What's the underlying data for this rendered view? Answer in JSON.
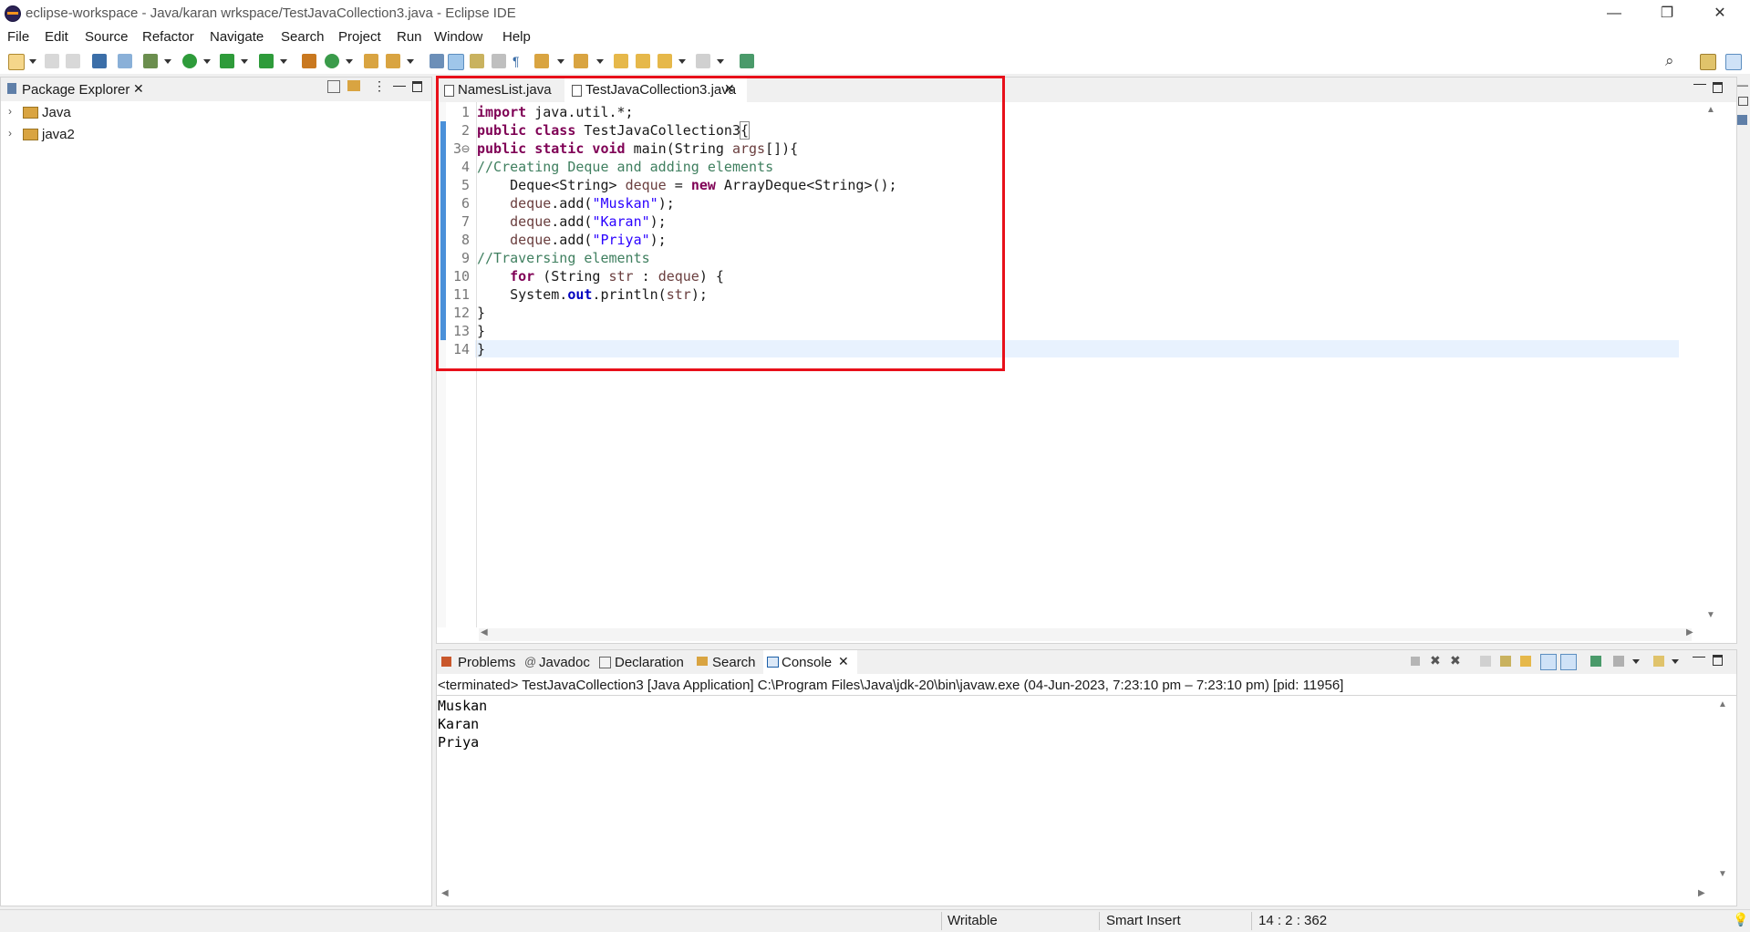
{
  "window": {
    "title": "eclipse-workspace - Java/karan wrkspace/TestJavaCollection3.java - Eclipse IDE",
    "minimize": "—",
    "restore": "❐",
    "close": "✕"
  },
  "menu": [
    "File",
    "Edit",
    "Source",
    "Refactor",
    "Navigate",
    "Search",
    "Project",
    "Run",
    "Window",
    "Help"
  ],
  "explorer": {
    "title": "Package Explorer",
    "projects": [
      "Java",
      "java2"
    ]
  },
  "editor": {
    "tabs": [
      "NamesList.java",
      "TestJavaCollection3.java"
    ],
    "active_tab": "TestJavaCollection3.java",
    "code_lines": [
      {
        "n": "1",
        "text": "import java.util.*;"
      },
      {
        "n": "2",
        "text": "public class TestJavaCollection3{"
      },
      {
        "n": "3⊖",
        "text": "public static void main(String args[]){"
      },
      {
        "n": "4",
        "text": "//Creating Deque and adding elements"
      },
      {
        "n": "5",
        "text": "    Deque<String> deque = new ArrayDeque<String>();"
      },
      {
        "n": "6",
        "text": "    deque.add(\"Muskan\");"
      },
      {
        "n": "7",
        "text": "    deque.add(\"Karan\");"
      },
      {
        "n": "8",
        "text": "    deque.add(\"Priya\");"
      },
      {
        "n": "9",
        "text": "//Traversing elements"
      },
      {
        "n": "10",
        "text": "    for (String str : deque) {"
      },
      {
        "n": "11",
        "text": "    System.out.println(str);"
      },
      {
        "n": "12",
        "text": "}"
      },
      {
        "n": "13",
        "text": "}"
      },
      {
        "n": "14",
        "text": "}"
      }
    ]
  },
  "bottom": {
    "tabs": [
      "Problems",
      "Javadoc",
      "Declaration",
      "Search",
      "Console"
    ],
    "active_tab": "Console",
    "console_header": "<terminated> TestJavaCollection3 [Java Application] C:\\Program Files\\Java\\jdk-20\\bin\\javaw.exe  (04-Jun-2023, 7:23:10 pm – 7:23:10 pm) [pid: 11956]",
    "output": [
      "Muskan",
      "Karan",
      "Priya"
    ]
  },
  "status": {
    "writable": "Writable",
    "insert_mode": "Smart Insert",
    "position": "14 : 2 : 362"
  },
  "colors": {
    "highlight_box": "#e8101a",
    "keyword": "#7f0055",
    "comment": "#3f7f5f",
    "string": "#2a00ff",
    "current_line": "#e8f2fe"
  }
}
